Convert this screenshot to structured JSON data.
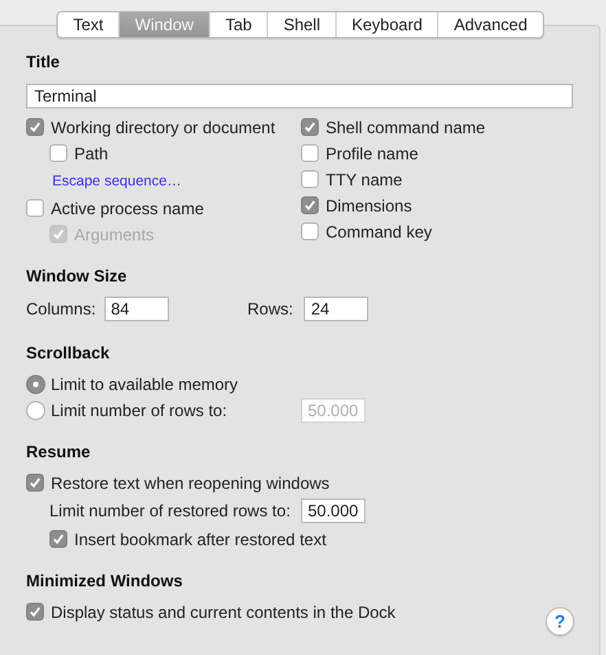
{
  "tabs": [
    {
      "label": "Text",
      "selected": false
    },
    {
      "label": "Window",
      "selected": true
    },
    {
      "label": "Tab",
      "selected": false
    },
    {
      "label": "Shell",
      "selected": false
    },
    {
      "label": "Keyboard",
      "selected": false
    },
    {
      "label": "Advanced",
      "selected": false
    }
  ],
  "title_section": {
    "heading": "Title",
    "field": {
      "value": "Terminal"
    },
    "left_options": [
      {
        "kind": "checkbox",
        "label": "Working directory or document",
        "checked": true,
        "disabled": false,
        "children": [
          {
            "kind": "checkbox",
            "label": "Path",
            "checked": false,
            "disabled": false
          },
          {
            "kind": "link",
            "label": "Escape sequence…"
          }
        ]
      },
      {
        "kind": "checkbox",
        "label": "Active process name",
        "checked": false,
        "disabled": false,
        "children": [
          {
            "kind": "checkbox",
            "label": "Arguments",
            "checked": true,
            "disabled": true
          }
        ]
      }
    ],
    "right_options": [
      {
        "kind": "checkbox",
        "label": "Shell command name",
        "checked": true,
        "disabled": false
      },
      {
        "kind": "checkbox",
        "label": "Profile name",
        "checked": false,
        "disabled": false
      },
      {
        "kind": "checkbox",
        "label": "TTY name",
        "checked": false,
        "disabled": false
      },
      {
        "kind": "checkbox",
        "label": "Dimensions",
        "checked": true,
        "disabled": false
      },
      {
        "kind": "checkbox",
        "label": "Command key",
        "checked": false,
        "disabled": false
      }
    ]
  },
  "window_size": {
    "heading": "Window Size",
    "fields": [
      {
        "label": "Columns:",
        "value": "84"
      },
      {
        "label": "Rows:",
        "value": "24"
      }
    ]
  },
  "scrollback": {
    "heading": "Scrollback",
    "options": [
      {
        "kind": "radio",
        "label": "Limit to available memory",
        "selected": true
      },
      {
        "kind": "radio",
        "label": "Limit number of rows to:",
        "selected": false,
        "field": {
          "value": "50.000",
          "disabled": true
        }
      }
    ]
  },
  "resume": {
    "heading": "Resume",
    "options": [
      {
        "kind": "checkbox",
        "label": "Restore text when reopening windows",
        "checked": true,
        "disabled": false,
        "children": [
          {
            "kind": "field",
            "label": "Limit number of restored rows to:",
            "value": "50.000",
            "disabled": false
          },
          {
            "kind": "checkbox",
            "label": "Insert bookmark after restored text",
            "checked": true,
            "disabled": false
          }
        ]
      }
    ]
  },
  "minimized_windows": {
    "heading": "Minimized Windows",
    "options": [
      {
        "kind": "checkbox",
        "label": "Display status and current contents in the Dock",
        "checked": true,
        "disabled": false
      }
    ]
  },
  "help_button": {
    "label": "?"
  }
}
